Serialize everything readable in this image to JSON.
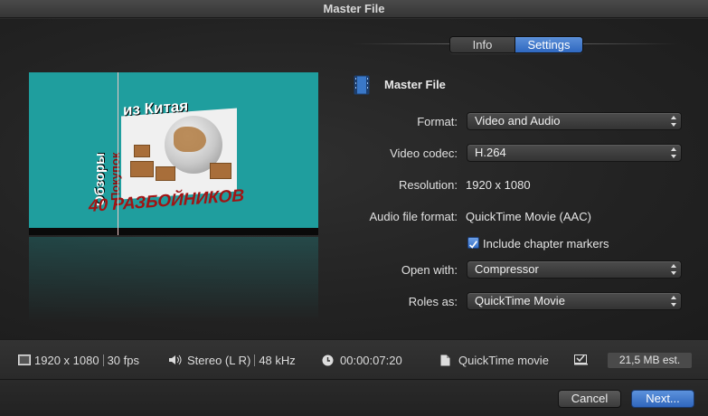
{
  "window": {
    "title": "Master File"
  },
  "tabs": [
    {
      "label": "Info",
      "selected": false
    },
    {
      "label": "Settings",
      "selected": true
    }
  ],
  "preview": {
    "thumbnail_text": {
      "line_top": "из Китая",
      "vertical_1": "Обзоры",
      "vertical_2": "Покупок",
      "bottom": "40 РАЗБОЙНИКОВ"
    },
    "background_color": "#1f9e9e"
  },
  "destination": {
    "icon": "film-strip-icon",
    "title": "Master File"
  },
  "form": {
    "format_label": "Format:",
    "format_value": "Video and Audio",
    "video_codec_label": "Video codec:",
    "video_codec_value": "H.264",
    "resolution_label": "Resolution:",
    "resolution_value": "1920 x 1080",
    "audio_format_label": "Audio file format:",
    "audio_format_value": "QuickTime Movie (AAC)",
    "chapter_markers_label": "Include chapter markers",
    "chapter_markers_checked": true,
    "open_with_label": "Open with:",
    "open_with_value": "Compressor",
    "roles_as_label": "Roles as:",
    "roles_as_value": "QuickTime Movie"
  },
  "infobar": {
    "resolution": "1920 x 1080",
    "fps": "30 fps",
    "audio": "Stereo (L R)",
    "sample_rate": "48 kHz",
    "duration": "00:00:07:20",
    "file_type": "QuickTime movie",
    "size_estimate": "21,5 MB est."
  },
  "buttons": {
    "cancel": "Cancel",
    "next": "Next..."
  },
  "colors": {
    "accent": "#3570c8",
    "preview_bg": "#1f9e9e",
    "title_red": "#a01414"
  }
}
